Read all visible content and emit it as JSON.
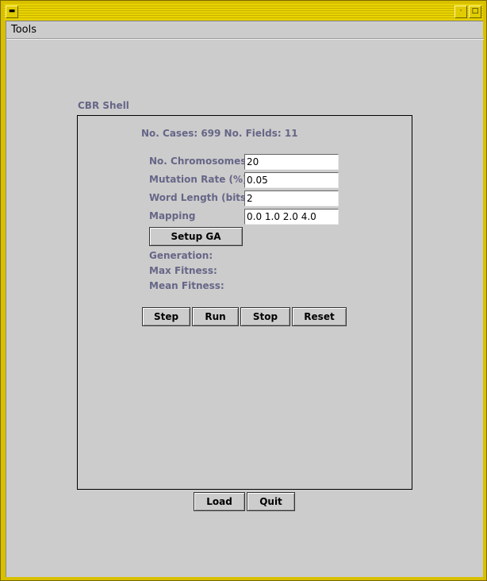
{
  "menu": {
    "tools_label": "Tools"
  },
  "panel": {
    "title": "CBR Shell",
    "info": "No. Cases: 699 No. Fields: 11",
    "fields": [
      {
        "label": "No. Chromosomes",
        "value": "20"
      },
      {
        "label": "Mutation Rate (%)",
        "value": "0.05"
      },
      {
        "label": "Word Length (bits)",
        "value": "2"
      },
      {
        "label": "Mapping",
        "value": "0.0 1.0 2.0 4.0"
      }
    ],
    "setup_label": "Setup GA",
    "stats": {
      "generation_label": "Generation:",
      "max_fitness_label": "Max Fitness:",
      "mean_fitness_label": "Mean Fitness:"
    },
    "controls": {
      "step_label": "Step",
      "run_label": "Run",
      "stop_label": "Stop",
      "reset_label": "Reset"
    }
  },
  "footer": {
    "load_label": "Load",
    "quit_label": "Quit"
  },
  "colors": {
    "frame": "#d8c000",
    "background": "#cccccc",
    "label": "#666688"
  }
}
